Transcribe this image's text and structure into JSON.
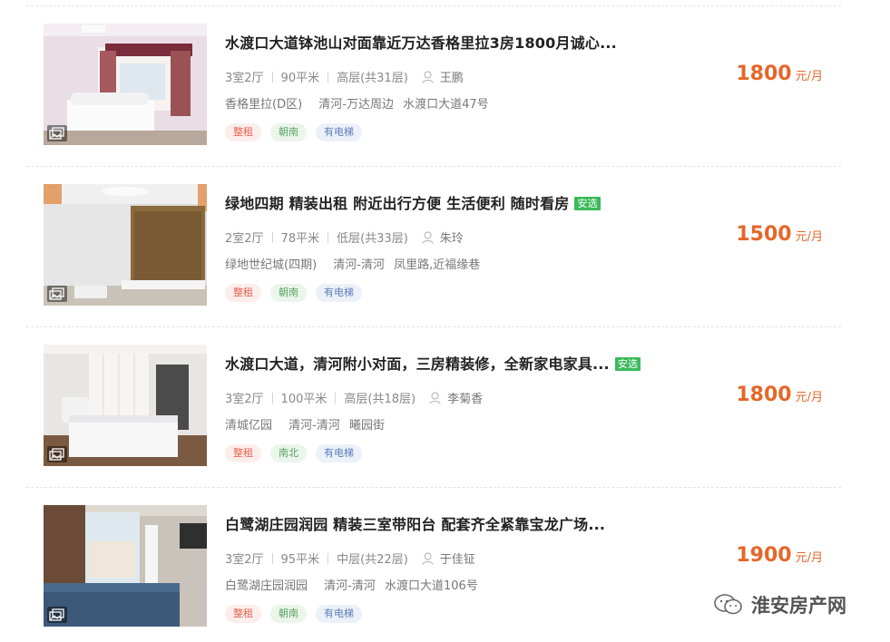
{
  "listings": [
    {
      "title": "水渡口大道钵池山对面靠近万达香格里拉3房1800月诚心...",
      "badge": "",
      "layout": "3室2厅",
      "area": "90平米",
      "floor": "高层(共31层)",
      "agent": "王鹏",
      "community": "香格里拉(D区)",
      "district": "清河-万达周边",
      "street": "水渡口大道47号",
      "tags": [
        "整租",
        "朝南",
        "有电梯"
      ],
      "price": "1800",
      "price_unit": "元/月"
    },
    {
      "title": "绿地四期 精装出租 附近出行方便 生活便利 随时看房",
      "badge": "安选",
      "layout": "2室2厅",
      "area": "78平米",
      "floor": "低层(共33层)",
      "agent": "朱玲",
      "community": "绿地世纪城(四期)",
      "district": "清河-清河",
      "street": "凤里路,近福缘巷",
      "tags": [
        "整租",
        "朝南",
        "有电梯"
      ],
      "price": "1500",
      "price_unit": "元/月"
    },
    {
      "title": "水渡口大道，清河附小对面，三房精装修，全新家电家具...",
      "badge": "安选",
      "layout": "3室2厅",
      "area": "100平米",
      "floor": "高层(共18层)",
      "agent": "李菊香",
      "community": "清城亿园",
      "district": "清河-清河",
      "street": "曦园街",
      "tags": [
        "整租",
        "南北",
        "有电梯"
      ],
      "price": "1800",
      "price_unit": "元/月"
    },
    {
      "title": "白鹭湖庄园润园 精装三室带阳台 配套齐全紧靠宝龙广场...",
      "badge": "",
      "layout": "3室2厅",
      "area": "95平米",
      "floor": "中层(共22层)",
      "agent": "于佳钲",
      "community": "白鹭湖庄园润园",
      "district": "清河-清河",
      "street": "水渡口大道106号",
      "tags": [
        "整租",
        "朝南",
        "有电梯"
      ],
      "price": "1900",
      "price_unit": "元/月"
    }
  ],
  "watermark": "淮安房产网",
  "icons": {
    "gallery": "image-gallery-icon",
    "agent": "person-icon",
    "watermark": "wechat-icon"
  },
  "colors": {
    "price": "#e4672a",
    "badge": "#3bb95b",
    "tag_red": "#e8604c",
    "tag_green": "#5aa362",
    "tag_blue": "#5c7eba"
  }
}
